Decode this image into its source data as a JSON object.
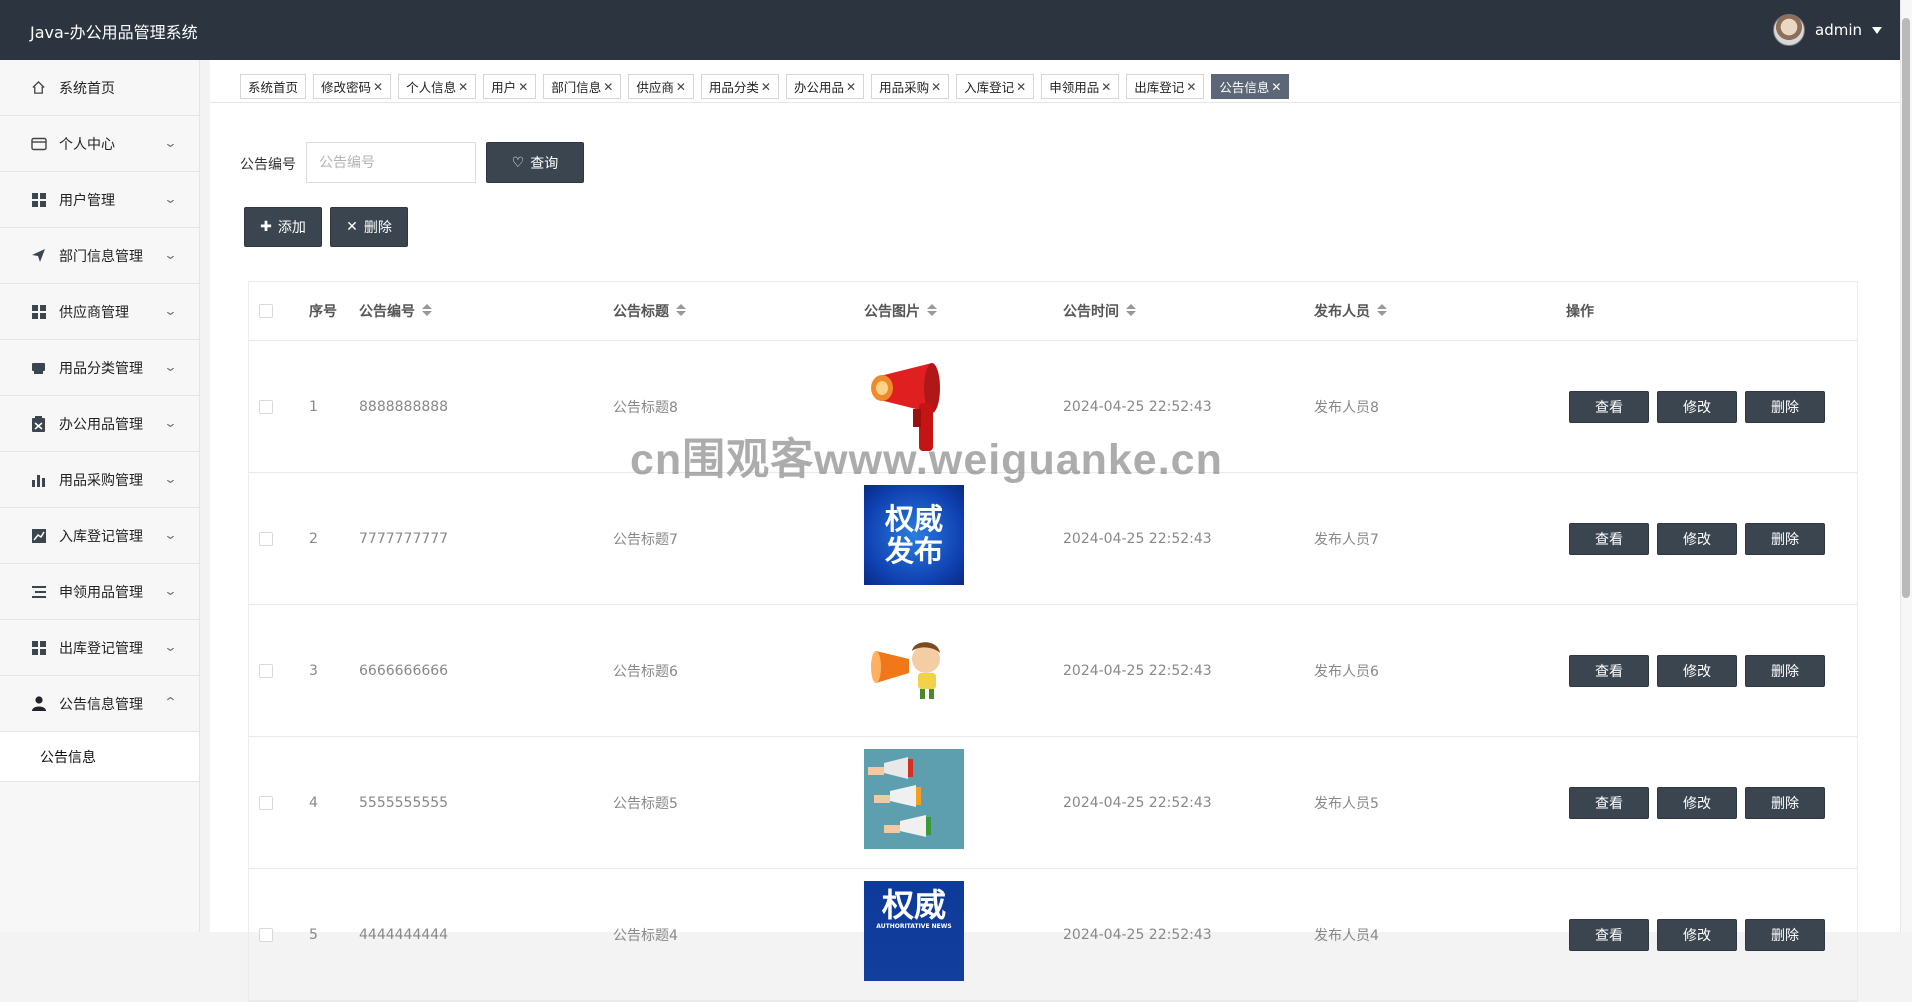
{
  "app": {
    "title": "Java-办公用品管理系统",
    "user": "admin"
  },
  "sidebar": {
    "items": [
      {
        "label": "系统首页",
        "icon": "home-icon"
      },
      {
        "label": "个人中心",
        "icon": "card-icon"
      },
      {
        "label": "用户管理",
        "icon": "grid-icon"
      },
      {
        "label": "部门信息管理",
        "icon": "send-icon"
      },
      {
        "label": "供应商管理",
        "icon": "grid-icon"
      },
      {
        "label": "用品分类管理",
        "icon": "printer-icon"
      },
      {
        "label": "办公用品管理",
        "icon": "clipboard-icon"
      },
      {
        "label": "用品采购管理",
        "icon": "bar-chart-icon"
      },
      {
        "label": "入库登记管理",
        "icon": "line-chart-icon"
      },
      {
        "label": "申领用品管理",
        "icon": "list-icon"
      },
      {
        "label": "出库登记管理",
        "icon": "grid-icon"
      },
      {
        "label": "公告信息管理",
        "icon": "user-icon"
      }
    ],
    "sub_items": [
      {
        "label": "公告信息"
      }
    ]
  },
  "tabs": [
    {
      "label": "系统首页",
      "closable": false
    },
    {
      "label": "修改密码",
      "closable": true
    },
    {
      "label": "个人信息",
      "closable": true
    },
    {
      "label": "用户",
      "closable": true
    },
    {
      "label": "部门信息",
      "closable": true
    },
    {
      "label": "供应商",
      "closable": true
    },
    {
      "label": "用品分类",
      "closable": true
    },
    {
      "label": "办公用品",
      "closable": true
    },
    {
      "label": "用品采购",
      "closable": true
    },
    {
      "label": "入库登记",
      "closable": true
    },
    {
      "label": "申领用品",
      "closable": true
    },
    {
      "label": "出库登记",
      "closable": true
    },
    {
      "label": "公告信息",
      "closable": true,
      "active": true
    }
  ],
  "search": {
    "label": "公告编号",
    "placeholder": "公告编号",
    "query_button": "查询"
  },
  "toolbar": {
    "add": "添加",
    "delete": "删除"
  },
  "table": {
    "headers": {
      "index": "序号",
      "code": "公告编号",
      "title": "公告标题",
      "image": "公告图片",
      "time": "公告时间",
      "publisher": "发布人员",
      "actions": "操作"
    },
    "rows": [
      {
        "index": "1",
        "code": "8888888888",
        "title": "公告标题8",
        "time": "2024-04-25 22:52:43",
        "publisher": "发布人员8",
        "image": "megaphone-red"
      },
      {
        "index": "2",
        "code": "7777777777",
        "title": "公告标题7",
        "time": "2024-04-25 22:52:43",
        "publisher": "发布人员7",
        "image": "authority-release",
        "image_text": [
          "权威",
          "发布"
        ]
      },
      {
        "index": "3",
        "code": "6666666666",
        "title": "公告标题6",
        "time": "2024-04-25 22:52:43",
        "publisher": "发布人员6",
        "image": "boy-megaphone"
      },
      {
        "index": "4",
        "code": "5555555555",
        "title": "公告标题5",
        "time": "2024-04-25 22:52:43",
        "publisher": "发布人员5",
        "image": "hands-megaphones"
      },
      {
        "index": "5",
        "code": "4444444444",
        "title": "公告标题4",
        "time": "2024-04-25 22:52:43",
        "publisher": "发布人员4",
        "image": "authority-release",
        "image_text": [
          "权威",
          "AUTHORITATIVE NEWS"
        ]
      }
    ],
    "row_actions": {
      "view": "查看",
      "edit": "修改",
      "delete": "删除"
    }
  },
  "watermark": "cn围观客www.weiguanke.cn",
  "colors": {
    "topbar": "#2c3440",
    "button": "#3b4550",
    "active_tab": "#5b6776"
  }
}
